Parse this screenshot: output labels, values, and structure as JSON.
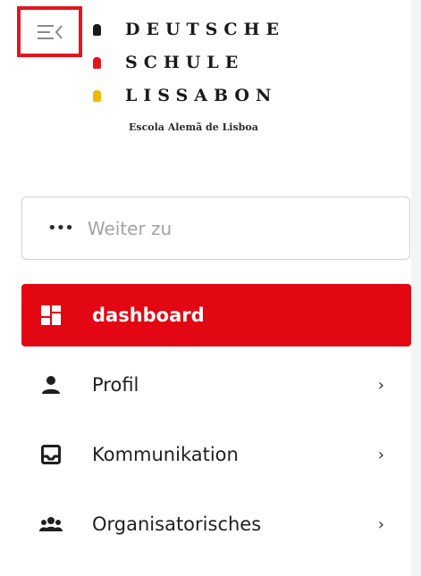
{
  "colors": {
    "accent": "#e30613",
    "highlight_border": "#e4161c",
    "logo_dot_1": "#1a1a1a",
    "logo_dot_2": "#e4161c",
    "logo_dot_3": "#f2b800"
  },
  "header": {
    "collapse_icon": "menu-collapse-icon"
  },
  "logo": {
    "line1": "DEUTSCHE",
    "line2": "SCHULE",
    "line3": "LISSABON",
    "subtitle": "Escola Alemã de Lisboa"
  },
  "search": {
    "icon": "ellipsis-icon",
    "placeholder": "Weiter zu",
    "value": ""
  },
  "nav": {
    "items": [
      {
        "label": "dashboard",
        "icon": "dashboard-icon",
        "active": true
      },
      {
        "label": "Profil",
        "icon": "person-icon",
        "active": false
      },
      {
        "label": "Kommunikation",
        "icon": "inbox-icon",
        "active": false
      },
      {
        "label": "Organisatorisches",
        "icon": "group-icon",
        "active": false
      }
    ]
  }
}
